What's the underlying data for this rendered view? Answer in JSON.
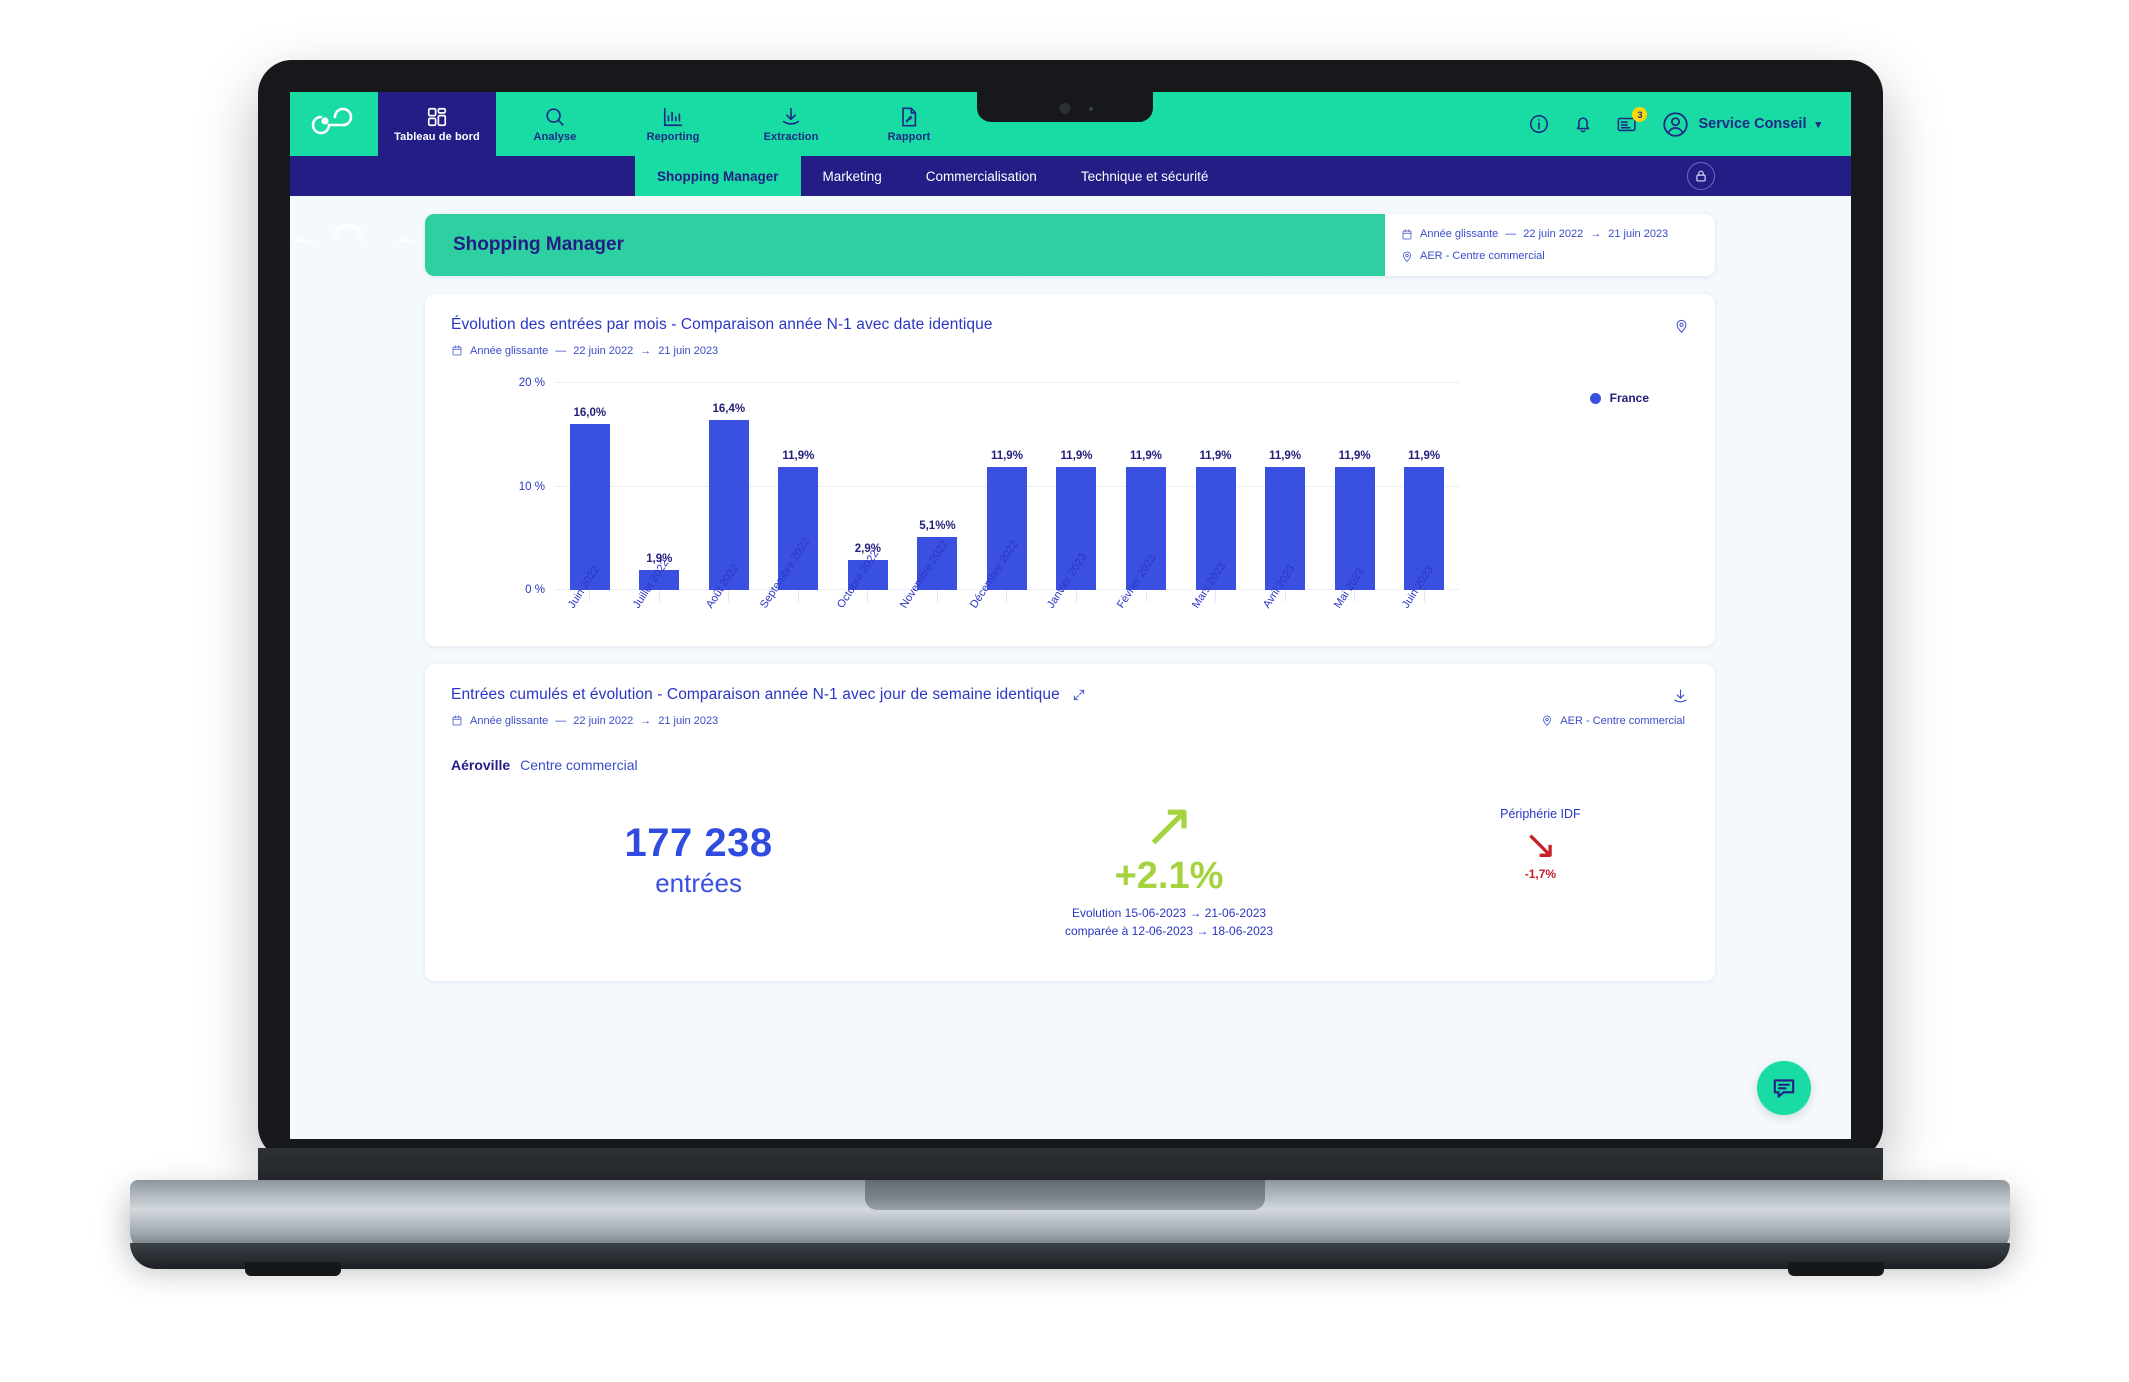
{
  "topnav": {
    "brand_icon": "qc-logo-icon",
    "items": [
      {
        "label": "Tableau de bord",
        "icon": "dashboard-grid-icon",
        "active": true
      },
      {
        "label": "Analyse",
        "icon": "search-icon",
        "active": false
      },
      {
        "label": "Reporting",
        "icon": "bar-chart-icon",
        "active": false
      },
      {
        "label": "Extraction",
        "icon": "download-icon",
        "active": false
      },
      {
        "label": "Rapport",
        "icon": "pdf-document-icon",
        "active": false
      }
    ],
    "right": {
      "info_icon": "info-circle-icon",
      "bell_icon": "bell-icon",
      "news_icon": "news-icon",
      "news_badge": "3",
      "avatar_icon": "user-avatar-icon",
      "user_name": "Service Conseil",
      "chevron": "▾"
    }
  },
  "subnav": {
    "items": [
      {
        "label": "Shopping Manager",
        "active": true
      },
      {
        "label": "Marketing",
        "active": false
      },
      {
        "label": "Commercialisation",
        "active": false
      },
      {
        "label": "Technique et sécurité",
        "active": false
      }
    ],
    "lock_icon": "lock-icon"
  },
  "banner": {
    "title": "Shopping Manager",
    "period_label": "Année glissante",
    "dash": "—",
    "date_from": "22 juin 2022",
    "arrow": "→",
    "date_to": "21 juin 2023",
    "location": "AER - Centre commercial",
    "calendar_icon": "calendar-icon",
    "pin_icon": "map-pin-icon"
  },
  "chart_card": {
    "title": "Évolution des entrées par mois - Comparaison année N-1 avec date identique",
    "period_label": "Année glissante",
    "dash": "—",
    "date_from": "22 juin 2022",
    "arrow": "→",
    "date_to": "21 juin 2023",
    "calendar_icon": "calendar-icon",
    "pin_icon": "map-pin-icon"
  },
  "chart_data": {
    "type": "bar",
    "title": "Évolution des entrées par mois - Comparaison année N-1 avec date identique",
    "xlabel": "",
    "ylabel": "",
    "ylim": [
      0,
      20
    ],
    "yticks": [
      "0 %",
      "10 %",
      "20 %"
    ],
    "ytick_values": [
      0,
      10,
      20
    ],
    "grid": true,
    "legend": [
      "France"
    ],
    "legend_position": "right",
    "series_color": "#3a50e0",
    "categories": [
      "Juin 2022",
      "Juillet 2022",
      "Août 2022",
      "Septembre 2022",
      "Octobre 2022",
      "Novembre 2022",
      "Décembre 2022",
      "Janvier 2023",
      "Février 2023",
      "Mars 2023",
      "Avril 2023",
      "Mai 2023",
      "Juin 2023"
    ],
    "values": [
      16.0,
      1.9,
      16.4,
      11.9,
      2.9,
      5.1,
      11.9,
      11.9,
      11.9,
      11.9,
      11.9,
      11.9,
      11.9
    ],
    "data_labels": [
      "16,0%",
      "1,9%",
      "16,4%",
      "11,9%",
      "2,9%",
      "5,1%%",
      "11,9%",
      "11,9%",
      "11,9%",
      "11,9%",
      "11,9%",
      "11,9%",
      "11,9%"
    ]
  },
  "kpi_card": {
    "title": "Entrées cumulés et évolution - Comparaison année N-1 avec jour de semaine identique",
    "expand_icon": "expand-arrows-icon",
    "download_icon": "download-icon",
    "calendar_icon": "calendar-icon",
    "pin_icon": "map-pin-icon",
    "period_label": "Année glissante",
    "dash": "—",
    "date_from": "22 juin 2022",
    "arrow": "→",
    "date_to": "21 juin 2023",
    "location": "AER - Centre commercial",
    "site_name": "Aéroville",
    "site_type": "Centre commercial",
    "total_value": "177 238",
    "total_unit": "entrées",
    "trend_arrow": "↗",
    "trend_value": "+2.1%",
    "trend_note_line1": "Evolution 15-06-2023 → 21-06-2023",
    "trend_note_line2": "comparée à 12-06-2023 → 18-06-2023",
    "secondary_label": "Périphérie IDF",
    "secondary_arrow": "↘",
    "secondary_value": "-1,7%"
  },
  "chat": {
    "icon": "chat-bubble-icon"
  },
  "colors": {
    "teal": "#19dca4",
    "navy": "#241d86",
    "bar_blue": "#3a50e0",
    "green": "#a4d33f",
    "red": "#c62128",
    "bg": "#e2eff6"
  }
}
